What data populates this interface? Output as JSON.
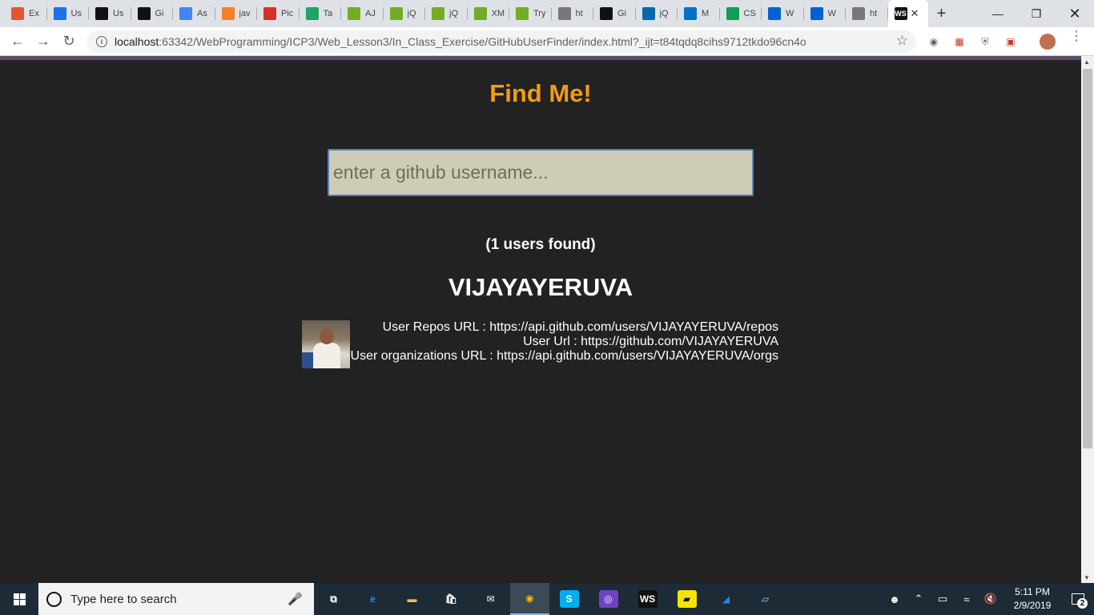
{
  "browser": {
    "tabs": [
      {
        "label": "Ex",
        "icon": "grid-icon",
        "color": "#e4572e"
      },
      {
        "label": "Us",
        "icon": "cap-icon",
        "color": "#1a73e8"
      },
      {
        "label": "Us",
        "icon": "github-icon",
        "color": "#111111"
      },
      {
        "label": "Gi",
        "icon": "github-icon",
        "color": "#111111"
      },
      {
        "label": "As",
        "icon": "google-icon",
        "color": "#4285f4"
      },
      {
        "label": "jav",
        "icon": "stackoverflow-icon",
        "color": "#f48024"
      },
      {
        "label": "Pic",
        "icon": "gmail-icon",
        "color": "#d93025"
      },
      {
        "label": "Ta",
        "icon": "drive-icon",
        "color": "#1fa463"
      },
      {
        "label": "AJ",
        "icon": "w3-icon",
        "color": "#73ad21"
      },
      {
        "label": "jQ",
        "icon": "w3-icon",
        "color": "#73ad21"
      },
      {
        "label": "jQ",
        "icon": "w3-icon",
        "color": "#73ad21"
      },
      {
        "label": "XM",
        "icon": "w3-icon",
        "color": "#73ad21"
      },
      {
        "label": "Try",
        "icon": "w3-icon",
        "color": "#73ad21"
      },
      {
        "label": "ht",
        "icon": "file-icon",
        "color": "#777777"
      },
      {
        "label": "Gi",
        "icon": "webstorm-icon",
        "color": "#111111"
      },
      {
        "label": "jQ",
        "icon": "jquery-icon",
        "color": "#0769ad"
      },
      {
        "label": "M",
        "icon": "outlook-icon",
        "color": "#0072c6"
      },
      {
        "label": "CS",
        "icon": "classroom-icon",
        "color": "#0f9d58"
      },
      {
        "label": "W",
        "icon": "box-icon",
        "color": "#0061d5"
      },
      {
        "label": "W",
        "icon": "box-icon",
        "color": "#0061d5"
      },
      {
        "label": "ht",
        "icon": "file-icon",
        "color": "#777777"
      }
    ],
    "active_tab": {
      "icon": "webstorm-icon",
      "glyph": "WS",
      "color": "#111111"
    },
    "url_host": "localhost",
    "url_rest": ":63342/WebProgramming/ICP3/Web_Lesson3/In_Class_Exercise/GitHubUserFinder/index.html?_ijt=t84tqdq8cihs9712tkdo96cn4o"
  },
  "page": {
    "title": "Find Me!",
    "search_placeholder": "enter a github username...",
    "found_text": "(1 users found)",
    "username": "VIJAYAYERUVA",
    "repos_line": "User Repos URL : https://api.github.com/users/VIJAYAYERUVA/repos",
    "url_line": "User Url : https://github.com/VIJAYAYERUVA",
    "orgs_line": "User organizations URL : https://api.github.com/users/VIJAYAYERUVA/orgs",
    "colors": {
      "title": "#f39c12",
      "background": "#222222",
      "input_bg": "#cfccb6",
      "input_border": "#5b7fb5"
    }
  },
  "taskbar": {
    "search_placeholder": "Type here to search",
    "apps": [
      {
        "name": "task-view-icon",
        "glyph": "⧉",
        "color": "#ffffff",
        "bg": "transparent"
      },
      {
        "name": "edge-icon",
        "glyph": "e",
        "color": "#1e90ff",
        "bg": "transparent"
      },
      {
        "name": "file-explorer-icon",
        "glyph": "▬",
        "color": "#f0c040",
        "bg": "transparent"
      },
      {
        "name": "store-icon",
        "glyph": "🛍",
        "color": "#ffffff",
        "bg": "transparent"
      },
      {
        "name": "mail-icon",
        "glyph": "✉",
        "color": "#ffffff",
        "bg": "transparent"
      },
      {
        "name": "chrome-icon",
        "glyph": "◉",
        "color": "#fbbc05",
        "bg": "transparent"
      },
      {
        "name": "skype-icon",
        "glyph": "S",
        "color": "#ffffff",
        "bg": "#00aff0"
      },
      {
        "name": "github-desktop-icon",
        "glyph": "◎",
        "color": "#ffffff",
        "bg": "#6f42c1"
      },
      {
        "name": "webstorm-icon",
        "glyph": "WS",
        "color": "#ffffff",
        "bg": "#111111"
      },
      {
        "name": "sticky-notes-icon",
        "glyph": "▰",
        "color": "#111111",
        "bg": "#f6e300"
      },
      {
        "name": "shark-icon",
        "glyph": "◢",
        "color": "#1e88e5",
        "bg": "transparent"
      },
      {
        "name": "notepad-icon",
        "glyph": "▱",
        "color": "#9ad0f5",
        "bg": "transparent"
      }
    ],
    "time": "5:11 PM",
    "date": "2/9/2019",
    "notifications": "2"
  }
}
